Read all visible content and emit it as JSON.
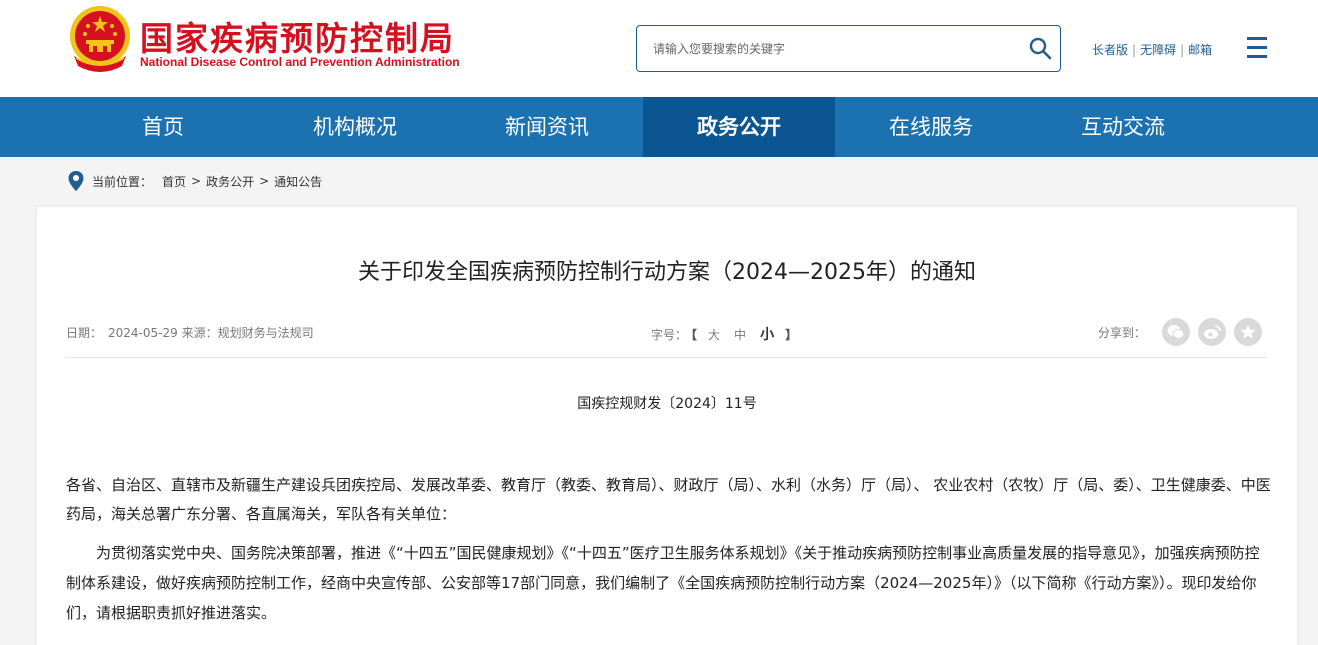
{
  "header": {
    "site_name_cn": "国家疾病预防控制局",
    "site_name_en": "National Disease Control and Prevention Administration",
    "search": {
      "placeholder": "请输入您要搜索的关键字"
    },
    "top_links": [
      {
        "label": "长者版"
      },
      {
        "label": "无障碍"
      },
      {
        "label": "邮箱"
      }
    ]
  },
  "nav": {
    "items": [
      {
        "label": "首页"
      },
      {
        "label": "机构概况"
      },
      {
        "label": "新闻资讯"
      },
      {
        "label": "政务公开",
        "active": true
      },
      {
        "label": "在线服务"
      },
      {
        "label": "互动交流"
      }
    ]
  },
  "breadcrumb": {
    "prefix": "当前位置：",
    "items": [
      "首页",
      "政务公开",
      "通知公告"
    ],
    "separator": ">"
  },
  "article": {
    "title": "关于印发全国疾病预防控制行动方案（2024—2025年）的通知",
    "date_label": "日期：",
    "date": "2024-05-29",
    "source_label": "来源：",
    "source": "规划财务与法规司",
    "fontsize_label": "字号：",
    "fontsize_open": "【",
    "fontsize_close": "】",
    "fontsize_options": [
      "大",
      "中",
      "小"
    ],
    "share_label": "分享到：",
    "doc_number": "国疾控规财发〔2024〕11号",
    "recipients": "各省、自治区、直辖市及新疆生产建设兵团疾控局、发展改革委、教育厅（教委、教育局）、财政厅（局）、水利（水务）厅（局）、 农业农村（农牧）厅（局、委）、卫生健康委、中医药局，海关总署广东分署、各直属海关，军队各有关单位：",
    "body": "为贯彻落实党中央、国务院决策部署，推进《“十四五”国民健康规划》《“十四五”医疗卫生服务体系规划》《关于推动疾病预防控制事业高质量发展的指导意见》，加强疾病预防控制体系建设，做好疾病预防控制工作，经商中央宣传部、公安部等17部门同意，我们编制了《全国疾病预防控制行动方案（2024—2025年）》（以下简称《行动方案》）。现印发给你们，请根据职责抓好推进落实。"
  },
  "colors": {
    "brand_red": "#d5101f",
    "nav_blue": "#1c71b1",
    "nav_active": "#0a5592",
    "link_blue": "#1f5d92"
  },
  "icons": {
    "emblem": "national-emblem-icon",
    "search": "search-icon",
    "menu": "hamburger-menu-icon",
    "location": "location-pin-icon",
    "share": [
      "wechat-icon",
      "weibo-icon",
      "favorite-star-icon"
    ]
  }
}
